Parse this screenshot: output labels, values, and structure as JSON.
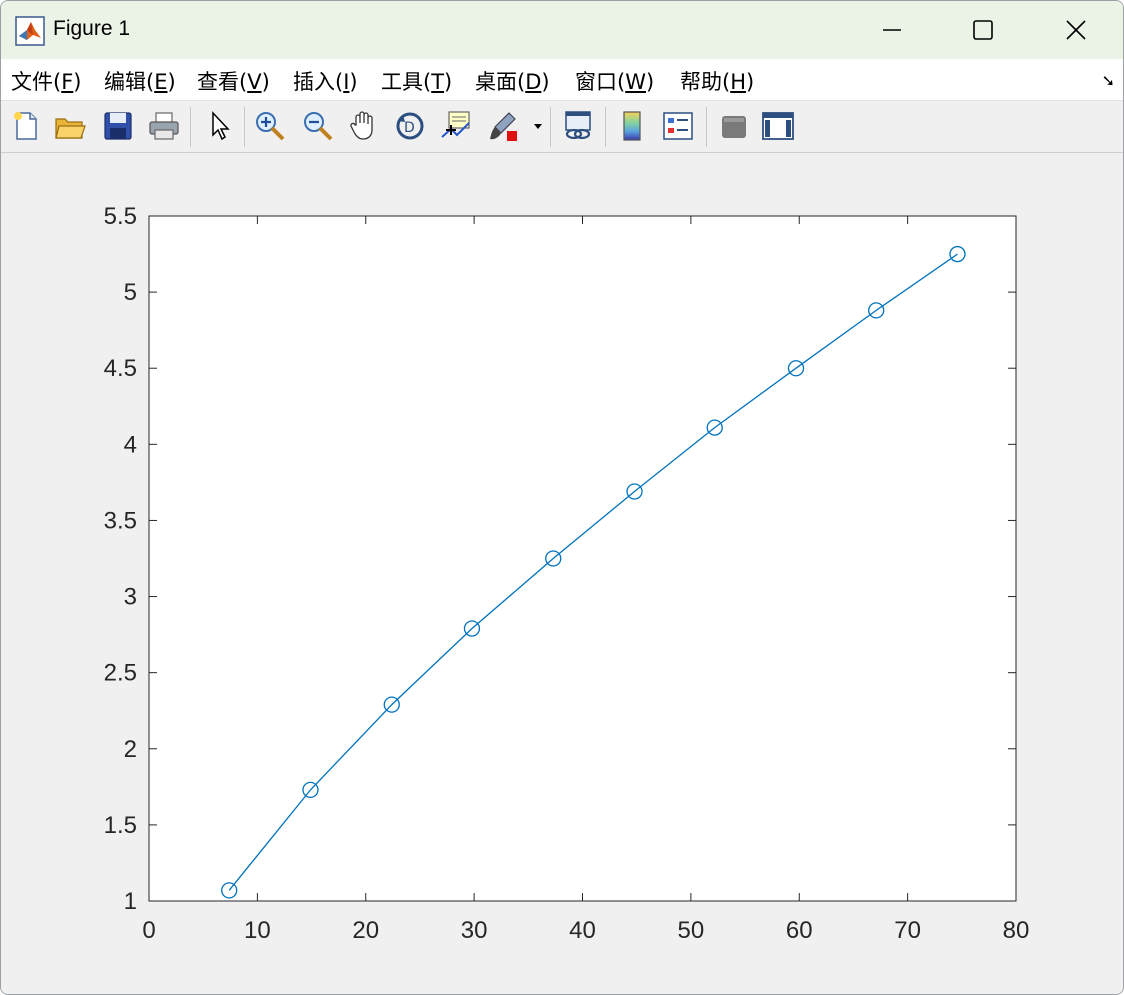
{
  "window": {
    "title": "Figure 1"
  },
  "menu": {
    "items": [
      {
        "label": "文件(",
        "key": "F",
        "end": ")"
      },
      {
        "label": "编辑(",
        "key": "E",
        "end": ")"
      },
      {
        "label": "查看(",
        "key": "V",
        "end": ")"
      },
      {
        "label": "插入(",
        "key": "I",
        "end": ")"
      },
      {
        "label": "工具(",
        "key": "T",
        "end": ")"
      },
      {
        "label": "桌面(",
        "key": "D",
        "end": ")"
      },
      {
        "label": "窗口(",
        "key": "W",
        "end": ")"
      },
      {
        "label": "帮助(",
        "key": "H",
        "end": ")"
      }
    ],
    "overflow_glyph": "➘"
  },
  "toolbar": {
    "buttons": [
      "new-figure",
      "open-file",
      "save-figure",
      "print-figure",
      "edit-plot",
      "zoom-in",
      "zoom-out",
      "pan",
      "rotate-3d",
      "data-cursor",
      "brush",
      "link-plot",
      "insert-colorbar",
      "insert-legend",
      "hide-plot-tools",
      "show-plot-tools"
    ]
  },
  "colors": {
    "series": "#0072bd",
    "axes": "#262626",
    "title_bar": "#eaf3e6"
  },
  "chart_data": {
    "type": "line",
    "marker": "circle",
    "x": [
      7.4,
      14.9,
      22.4,
      29.8,
      37.3,
      44.8,
      52.2,
      59.7,
      67.1,
      74.6
    ],
    "y": [
      1.07,
      1.73,
      2.29,
      2.79,
      3.25,
      3.69,
      4.11,
      4.5,
      4.88,
      5.25
    ],
    "xlim": [
      0,
      80
    ],
    "ylim": [
      1,
      5.5
    ],
    "xticks": [
      "0",
      "10",
      "20",
      "30",
      "40",
      "50",
      "60",
      "70",
      "80"
    ],
    "yticks": [
      "1",
      "1.5",
      "2",
      "2.5",
      "3",
      "3.5",
      "4",
      "4.5",
      "5",
      "5.5"
    ],
    "grid": false,
    "title": "",
    "xlabel": "",
    "ylabel": ""
  }
}
